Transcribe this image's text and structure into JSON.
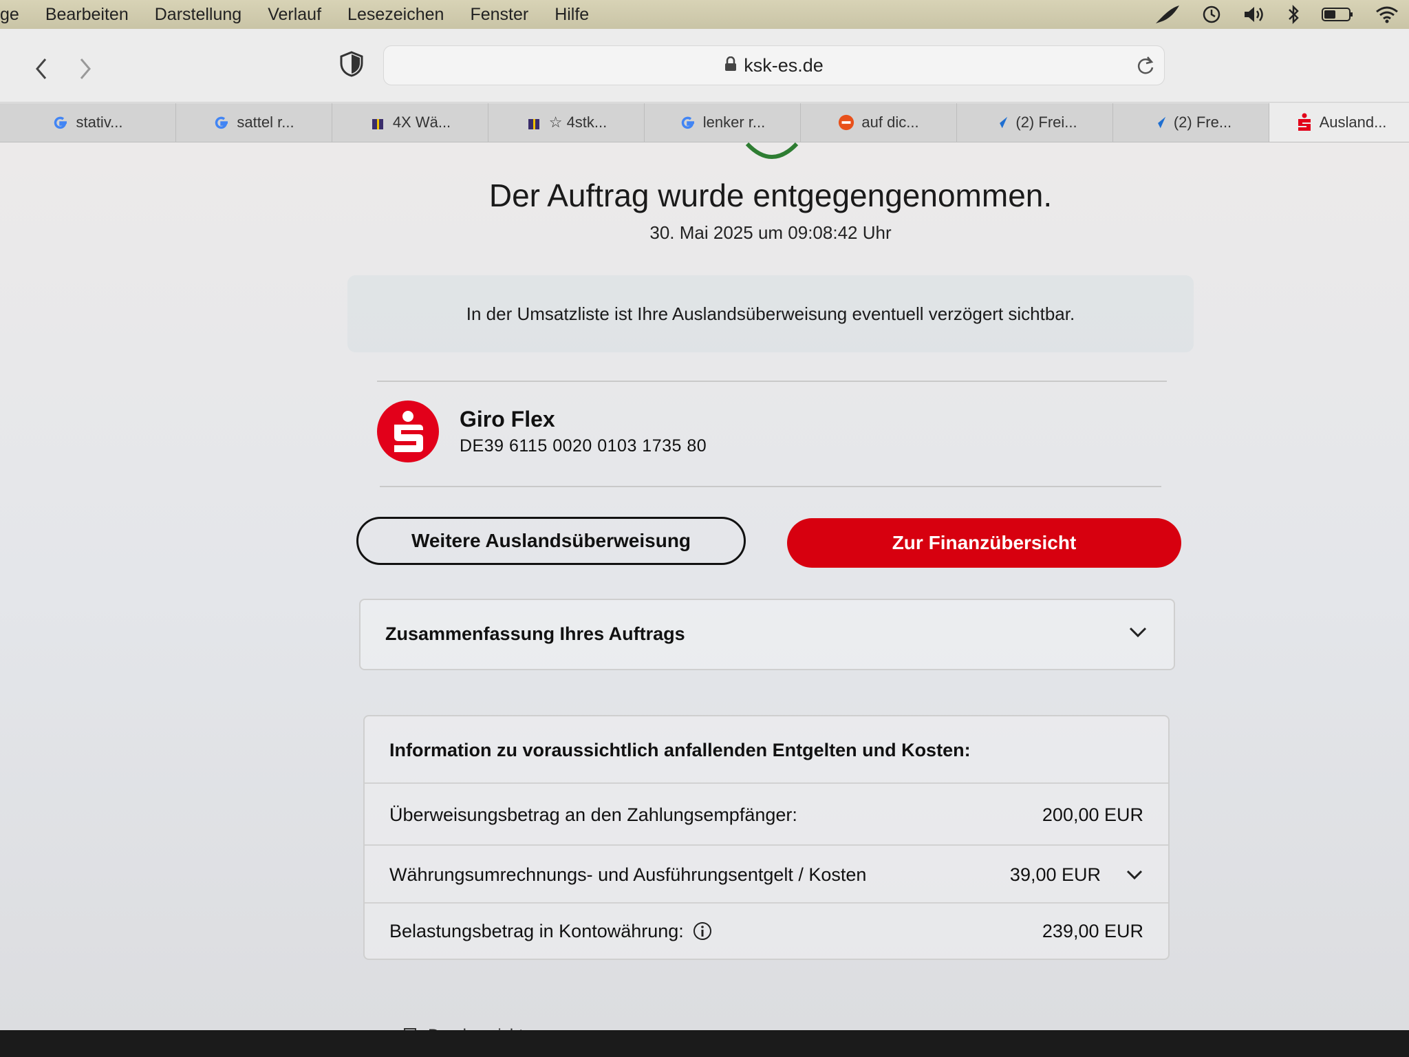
{
  "menubar": {
    "items": [
      "ge",
      "Bearbeiten",
      "Darstellung",
      "Verlauf",
      "Lesezeichen",
      "Fenster",
      "Hilfe"
    ]
  },
  "toolbar": {
    "url": "ksk-es.de"
  },
  "tabs": [
    {
      "label": "stativ...",
      "icon": "google-icon"
    },
    {
      "label": "sattel r...",
      "icon": "google-icon"
    },
    {
      "label": "4X Wä...",
      "icon": "gift-icon"
    },
    {
      "label": "☆ 4stk...",
      "icon": "gift-icon"
    },
    {
      "label": "lenker r...",
      "icon": "google-icon"
    },
    {
      "label": "auf dic...",
      "icon": "mobile-de-icon"
    },
    {
      "label": "(2) Frei...",
      "icon": "bird-icon"
    },
    {
      "label": "(2) Fre...",
      "icon": "bird-icon"
    },
    {
      "label": "Ausland...",
      "icon": "sparkasse-icon"
    }
  ],
  "confirmation": {
    "title": "Der Auftrag wurde entgegengenommen.",
    "datetime": "30. Mai 2025 um 09:08:42 Uhr",
    "notice": "In der Umsatzliste ist Ihre Auslandsüberweisung eventuell verzögert sichtbar."
  },
  "account": {
    "name": "Giro Flex",
    "iban": "DE39 6115 0020 0103 1735 80"
  },
  "actions": {
    "another_transfer": "Weitere Auslandsüberweisung",
    "overview": "Zur Finanzübersicht"
  },
  "summary": {
    "label": "Zusammenfassung Ihres Auftrags"
  },
  "costs": {
    "heading": "Information zu voraussichtlich anfallenden Entgelten und Kosten:",
    "rows": [
      {
        "label": "Überweisungsbetrag an den Zahlungsempfänger:",
        "value": "200,00 EUR"
      },
      {
        "label": "Währungsumrechnungs- und Ausführungsentgelt / Kosten",
        "value": "39,00 EUR"
      },
      {
        "label": "Belastungsbetrag in Kontowährung:",
        "value": "239,00 EUR"
      }
    ]
  },
  "footer": {
    "print": "Druckansicht"
  },
  "colors": {
    "brand_red": "#d7000f",
    "sparkasse_red": "#e2001a",
    "check_green": "#2e7d32"
  }
}
